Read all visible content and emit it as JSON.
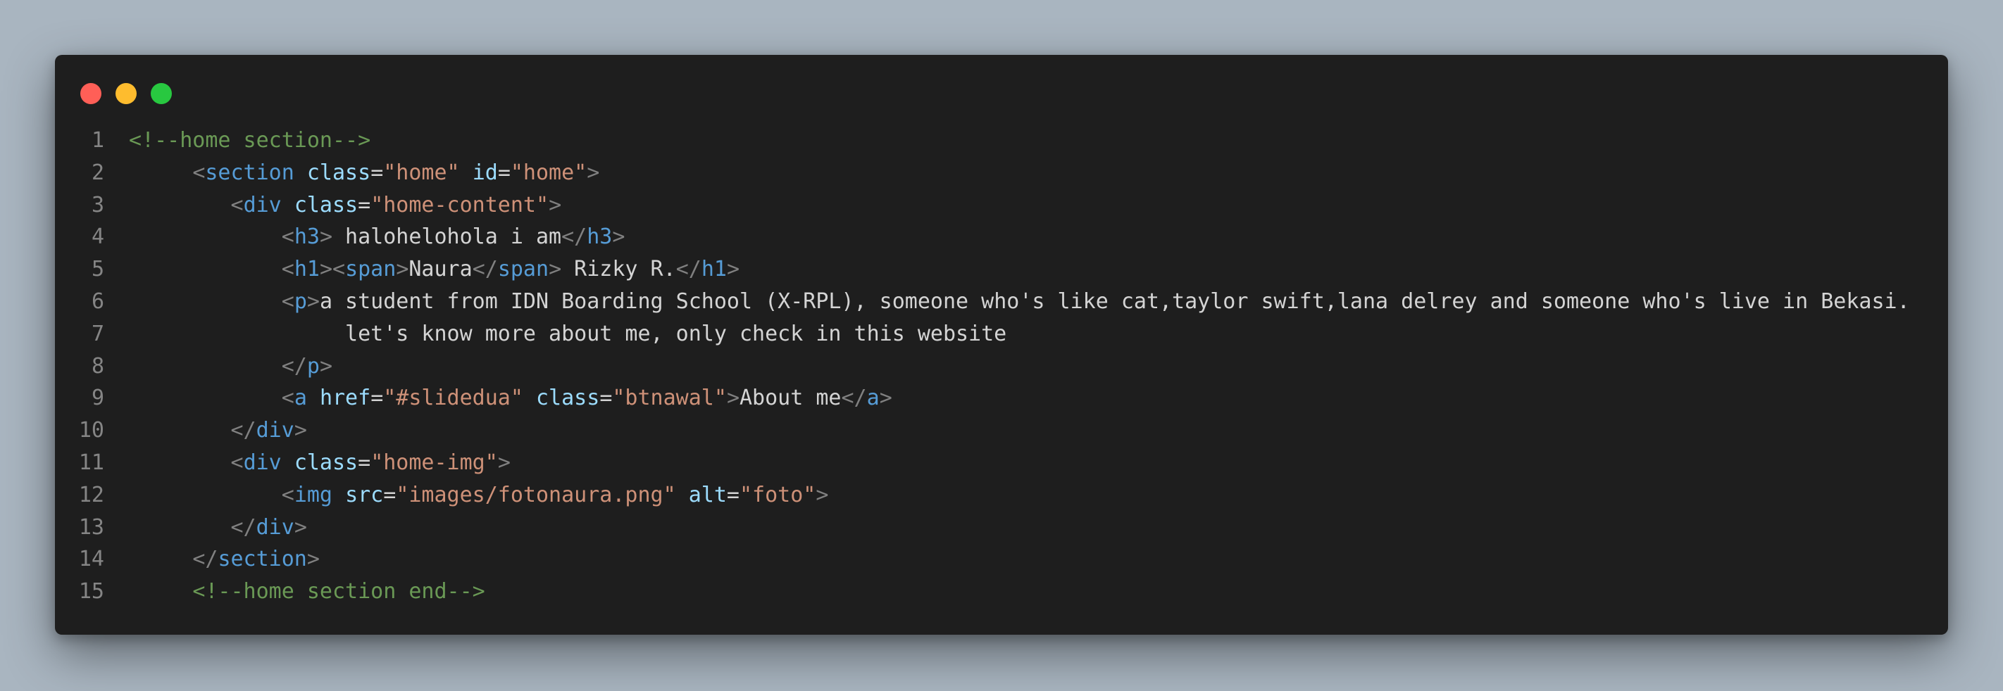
{
  "editor": {
    "window_controls": [
      "close",
      "minimize",
      "zoom"
    ],
    "colors": {
      "background": "#1e1e1e",
      "line_number": "#858585",
      "comment": "#6a9955",
      "tag": "#569cd6",
      "bracket": "#808080",
      "attribute": "#9cdcfe",
      "string": "#ce9178",
      "text": "#d4d4d4"
    },
    "lines": [
      {
        "number": "1",
        "indent": "",
        "tokens": [
          {
            "t": "comment",
            "v": "<!--home section-->"
          }
        ]
      },
      {
        "number": "2",
        "indent": "     ",
        "tokens": [
          {
            "t": "bracket",
            "v": "<"
          },
          {
            "t": "tag",
            "v": "section"
          },
          {
            "t": "text",
            "v": " "
          },
          {
            "t": "attr",
            "v": "class"
          },
          {
            "t": "punct",
            "v": "="
          },
          {
            "t": "string",
            "v": "\"home\""
          },
          {
            "t": "text",
            "v": " "
          },
          {
            "t": "attr",
            "v": "id"
          },
          {
            "t": "punct",
            "v": "="
          },
          {
            "t": "string",
            "v": "\"home\""
          },
          {
            "t": "bracket",
            "v": ">"
          }
        ]
      },
      {
        "number": "3",
        "indent": "        ",
        "tokens": [
          {
            "t": "bracket",
            "v": "<"
          },
          {
            "t": "tag",
            "v": "div"
          },
          {
            "t": "text",
            "v": " "
          },
          {
            "t": "attr",
            "v": "class"
          },
          {
            "t": "punct",
            "v": "="
          },
          {
            "t": "string",
            "v": "\"home-content\""
          },
          {
            "t": "bracket",
            "v": ">"
          }
        ]
      },
      {
        "number": "4",
        "indent": "            ",
        "tokens": [
          {
            "t": "bracket",
            "v": "<"
          },
          {
            "t": "tag",
            "v": "h3"
          },
          {
            "t": "bracket",
            "v": ">"
          },
          {
            "t": "text",
            "v": " halohelohola i am"
          },
          {
            "t": "bracket",
            "v": "</"
          },
          {
            "t": "tag",
            "v": "h3"
          },
          {
            "t": "bracket",
            "v": ">"
          }
        ]
      },
      {
        "number": "5",
        "indent": "            ",
        "tokens": [
          {
            "t": "bracket",
            "v": "<"
          },
          {
            "t": "tag",
            "v": "h1"
          },
          {
            "t": "bracket",
            "v": ">"
          },
          {
            "t": "bracket",
            "v": "<"
          },
          {
            "t": "tag",
            "v": "span"
          },
          {
            "t": "bracket",
            "v": ">"
          },
          {
            "t": "text",
            "v": "Naura"
          },
          {
            "t": "bracket",
            "v": "</"
          },
          {
            "t": "tag",
            "v": "span"
          },
          {
            "t": "bracket",
            "v": ">"
          },
          {
            "t": "text",
            "v": " Rizky R."
          },
          {
            "t": "bracket",
            "v": "</"
          },
          {
            "t": "tag",
            "v": "h1"
          },
          {
            "t": "bracket",
            "v": ">"
          }
        ]
      },
      {
        "number": "6",
        "indent": "            ",
        "tokens": [
          {
            "t": "bracket",
            "v": "<"
          },
          {
            "t": "tag",
            "v": "p"
          },
          {
            "t": "bracket",
            "v": ">"
          },
          {
            "t": "text",
            "v": "a student from IDN Boarding School (X-RPL), someone who's like cat,taylor swift,lana delrey and someone who's live in Bekasi."
          }
        ]
      },
      {
        "number": "7",
        "indent": "                 ",
        "tokens": [
          {
            "t": "text",
            "v": "let's know more about me, only check in this website"
          }
        ]
      },
      {
        "number": "8",
        "indent": "            ",
        "tokens": [
          {
            "t": "bracket",
            "v": "</"
          },
          {
            "t": "tag",
            "v": "p"
          },
          {
            "t": "bracket",
            "v": ">"
          }
        ]
      },
      {
        "number": "9",
        "indent": "            ",
        "tokens": [
          {
            "t": "bracket",
            "v": "<"
          },
          {
            "t": "tag",
            "v": "a"
          },
          {
            "t": "text",
            "v": " "
          },
          {
            "t": "attr",
            "v": "href"
          },
          {
            "t": "punct",
            "v": "="
          },
          {
            "t": "string",
            "v": "\"#slidedua\""
          },
          {
            "t": "text",
            "v": " "
          },
          {
            "t": "attr",
            "v": "class"
          },
          {
            "t": "punct",
            "v": "="
          },
          {
            "t": "string",
            "v": "\"btnawal\""
          },
          {
            "t": "bracket",
            "v": ">"
          },
          {
            "t": "text",
            "v": "About me"
          },
          {
            "t": "bracket",
            "v": "</"
          },
          {
            "t": "tag",
            "v": "a"
          },
          {
            "t": "bracket",
            "v": ">"
          }
        ]
      },
      {
        "number": "10",
        "indent": "        ",
        "tokens": [
          {
            "t": "bracket",
            "v": "</"
          },
          {
            "t": "tag",
            "v": "div"
          },
          {
            "t": "bracket",
            "v": ">"
          }
        ]
      },
      {
        "number": "11",
        "indent": "        ",
        "tokens": [
          {
            "t": "bracket",
            "v": "<"
          },
          {
            "t": "tag",
            "v": "div"
          },
          {
            "t": "text",
            "v": " "
          },
          {
            "t": "attr",
            "v": "class"
          },
          {
            "t": "punct",
            "v": "="
          },
          {
            "t": "string",
            "v": "\"home-img\""
          },
          {
            "t": "bracket",
            "v": ">"
          }
        ]
      },
      {
        "number": "12",
        "indent": "            ",
        "tokens": [
          {
            "t": "bracket",
            "v": "<"
          },
          {
            "t": "tag",
            "v": "img"
          },
          {
            "t": "text",
            "v": " "
          },
          {
            "t": "attr",
            "v": "src"
          },
          {
            "t": "punct",
            "v": "="
          },
          {
            "t": "string",
            "v": "\"images/fotonaura.png\""
          },
          {
            "t": "text",
            "v": " "
          },
          {
            "t": "attr",
            "v": "alt"
          },
          {
            "t": "punct",
            "v": "="
          },
          {
            "t": "string",
            "v": "\"foto\""
          },
          {
            "t": "bracket",
            "v": ">"
          }
        ]
      },
      {
        "number": "13",
        "indent": "        ",
        "tokens": [
          {
            "t": "bracket",
            "v": "</"
          },
          {
            "t": "tag",
            "v": "div"
          },
          {
            "t": "bracket",
            "v": ">"
          }
        ]
      },
      {
        "number": "14",
        "indent": "     ",
        "tokens": [
          {
            "t": "bracket",
            "v": "</"
          },
          {
            "t": "tag",
            "v": "section"
          },
          {
            "t": "bracket",
            "v": ">"
          }
        ]
      },
      {
        "number": "15",
        "indent": "     ",
        "tokens": [
          {
            "t": "comment",
            "v": "<!--home section end-->"
          }
        ]
      }
    ]
  }
}
